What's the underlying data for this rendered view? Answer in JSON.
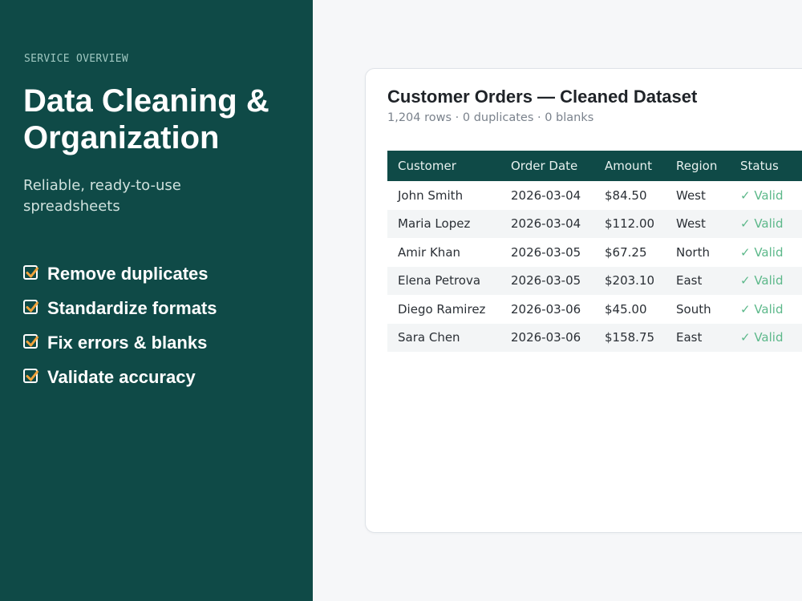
{
  "sidebar": {
    "eyebrow": "SERVICE OVERVIEW",
    "title": "Data Cleaning & Organization",
    "subtitle": "Reliable, ready-to-use spreadsheets",
    "features": [
      {
        "label": "Remove duplicates",
        "icon": "checkbox-checked-icon"
      },
      {
        "label": "Standardize formats",
        "icon": "checkbox-checked-icon"
      },
      {
        "label": "Fix errors & blanks",
        "icon": "checkbox-checked-icon"
      },
      {
        "label": "Validate accuracy",
        "icon": "checkbox-checked-icon"
      }
    ]
  },
  "card": {
    "title": "Customer Orders — Cleaned Dataset",
    "meta": "1,204 rows · 0 duplicates · 0 blanks",
    "columns": [
      "Customer",
      "Order Date",
      "Amount",
      "Region",
      "Status"
    ],
    "rows": [
      [
        "John Smith",
        "2026-03-04",
        "$84.50",
        "West",
        "✓ Valid"
      ],
      [
        "Maria Lopez",
        "2026-03-04",
        "$112.00",
        "West",
        "✓ Valid"
      ],
      [
        "Amir Khan",
        "2026-03-05",
        "$67.25",
        "North",
        "✓ Valid"
      ],
      [
        "Elena Petrova",
        "2026-03-05",
        "$203.10",
        "East",
        "✓ Valid"
      ],
      [
        "Diego Ramirez",
        "2026-03-06",
        "$45.00",
        "South",
        "✓ Valid"
      ],
      [
        "Sara Chen",
        "2026-03-06",
        "$158.75",
        "East",
        "✓ Valid"
      ]
    ]
  },
  "colors": {
    "sidebar_bg": "#0f4a47",
    "accent_check": "#f0a23a",
    "valid_status": "#5cb88a",
    "page_bg": "#f6f7f9"
  }
}
